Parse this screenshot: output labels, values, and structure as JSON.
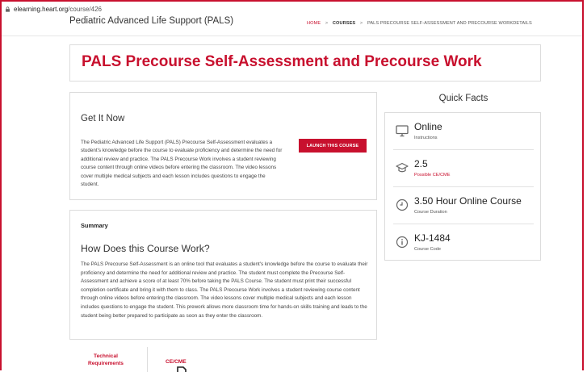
{
  "browser": {
    "host": "elearning.heart.org",
    "path": "/course/426"
  },
  "header": {
    "site_title": "Pediatric Advanced Life Support (PALS)",
    "breadcrumb": {
      "home": "HOME",
      "sep": ">",
      "courses": "COURSES",
      "current": "PALS PRECOURSE SELF-ASSESSMENT AND PRECOURSE WORKDETAILS"
    }
  },
  "page_title": "PALS Precourse Self-Assessment and Precourse Work",
  "get_it_now": {
    "heading": "Get It Now",
    "body": "The Pediatric Advanced Life Support (PALS) Precourse Self-Assessment evaluates a student's knowledge before the course to evaluate proficiency and determine the need for additional review and practice. The PALS Precourse Work involves a student reviewing course content through online videos before entering the classroom. The video lessons cover multiple medical subjects and each lesson includes questions to engage the student.",
    "launch_label": "LAUNCH THIS COURSE"
  },
  "summary": {
    "label": "Summary",
    "heading": "How Does this Course Work?",
    "body": "The PALS Precourse Self-Assessment is an online tool that evaluates a student's knowledge before the course to evaluate their proficiency and determine the need for additional review and practice. The student must complete the Precourse Self-Assessment and achieve a score of at least 70% before taking the PALS Course. The student must print their successful completion certificate and bring it with them to class. The PALS Precourse Work involves a student reviewing course content through online videos before entering the classroom. The video lessons cover multiple medical subjects and each lesson includes questions to engage the student. This prework allows more classroom time for hands-on skills training and leads to the student being better prepared to participate as soon as they enter the classroom."
  },
  "quick_facts": {
    "title": "Quick Facts",
    "items": [
      {
        "icon": "monitor-icon",
        "value": "Online",
        "label": "Instructions"
      },
      {
        "icon": "graduation-cap-icon",
        "value": "2.5",
        "label": "Possible CE/CME"
      },
      {
        "icon": "clock-icon",
        "value": "3.50 Hour Online Course",
        "label": "Course Duration"
      },
      {
        "icon": "info-icon",
        "value": "KJ-1484",
        "label": "Course Code"
      }
    ]
  },
  "bottom_tabs": {
    "technical": "Technical Requirements",
    "cecme": "CE/CME"
  },
  "colors": {
    "accent": "#c8102e",
    "border": "#dcdcdc",
    "text": "#333333"
  }
}
